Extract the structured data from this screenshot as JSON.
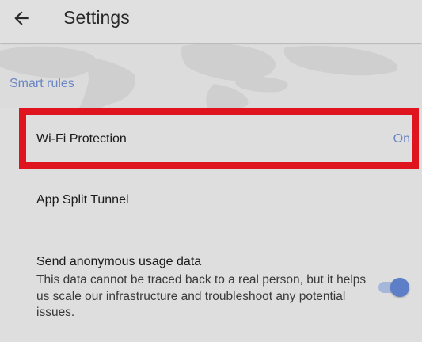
{
  "app_bar": {
    "title": "Settings",
    "back_icon": "arrow-back-icon"
  },
  "section": {
    "label": "Smart rules"
  },
  "rows": {
    "wifi_protection": {
      "label": "Wi-Fi Protection",
      "value": "On"
    },
    "app_split_tunnel": {
      "label": "App Split Tunnel"
    },
    "usage_data": {
      "title": "Send anonymous usage data",
      "description": "This data cannot be traced back to a real person, but it helps us scale our infrastructure and troubleshoot any potential issues.",
      "toggle_on": true
    }
  },
  "colors": {
    "accent": "#5c7fc8",
    "accent_text": "#6a86c2",
    "highlight_border": "#e0141e",
    "background": "#dedede"
  }
}
